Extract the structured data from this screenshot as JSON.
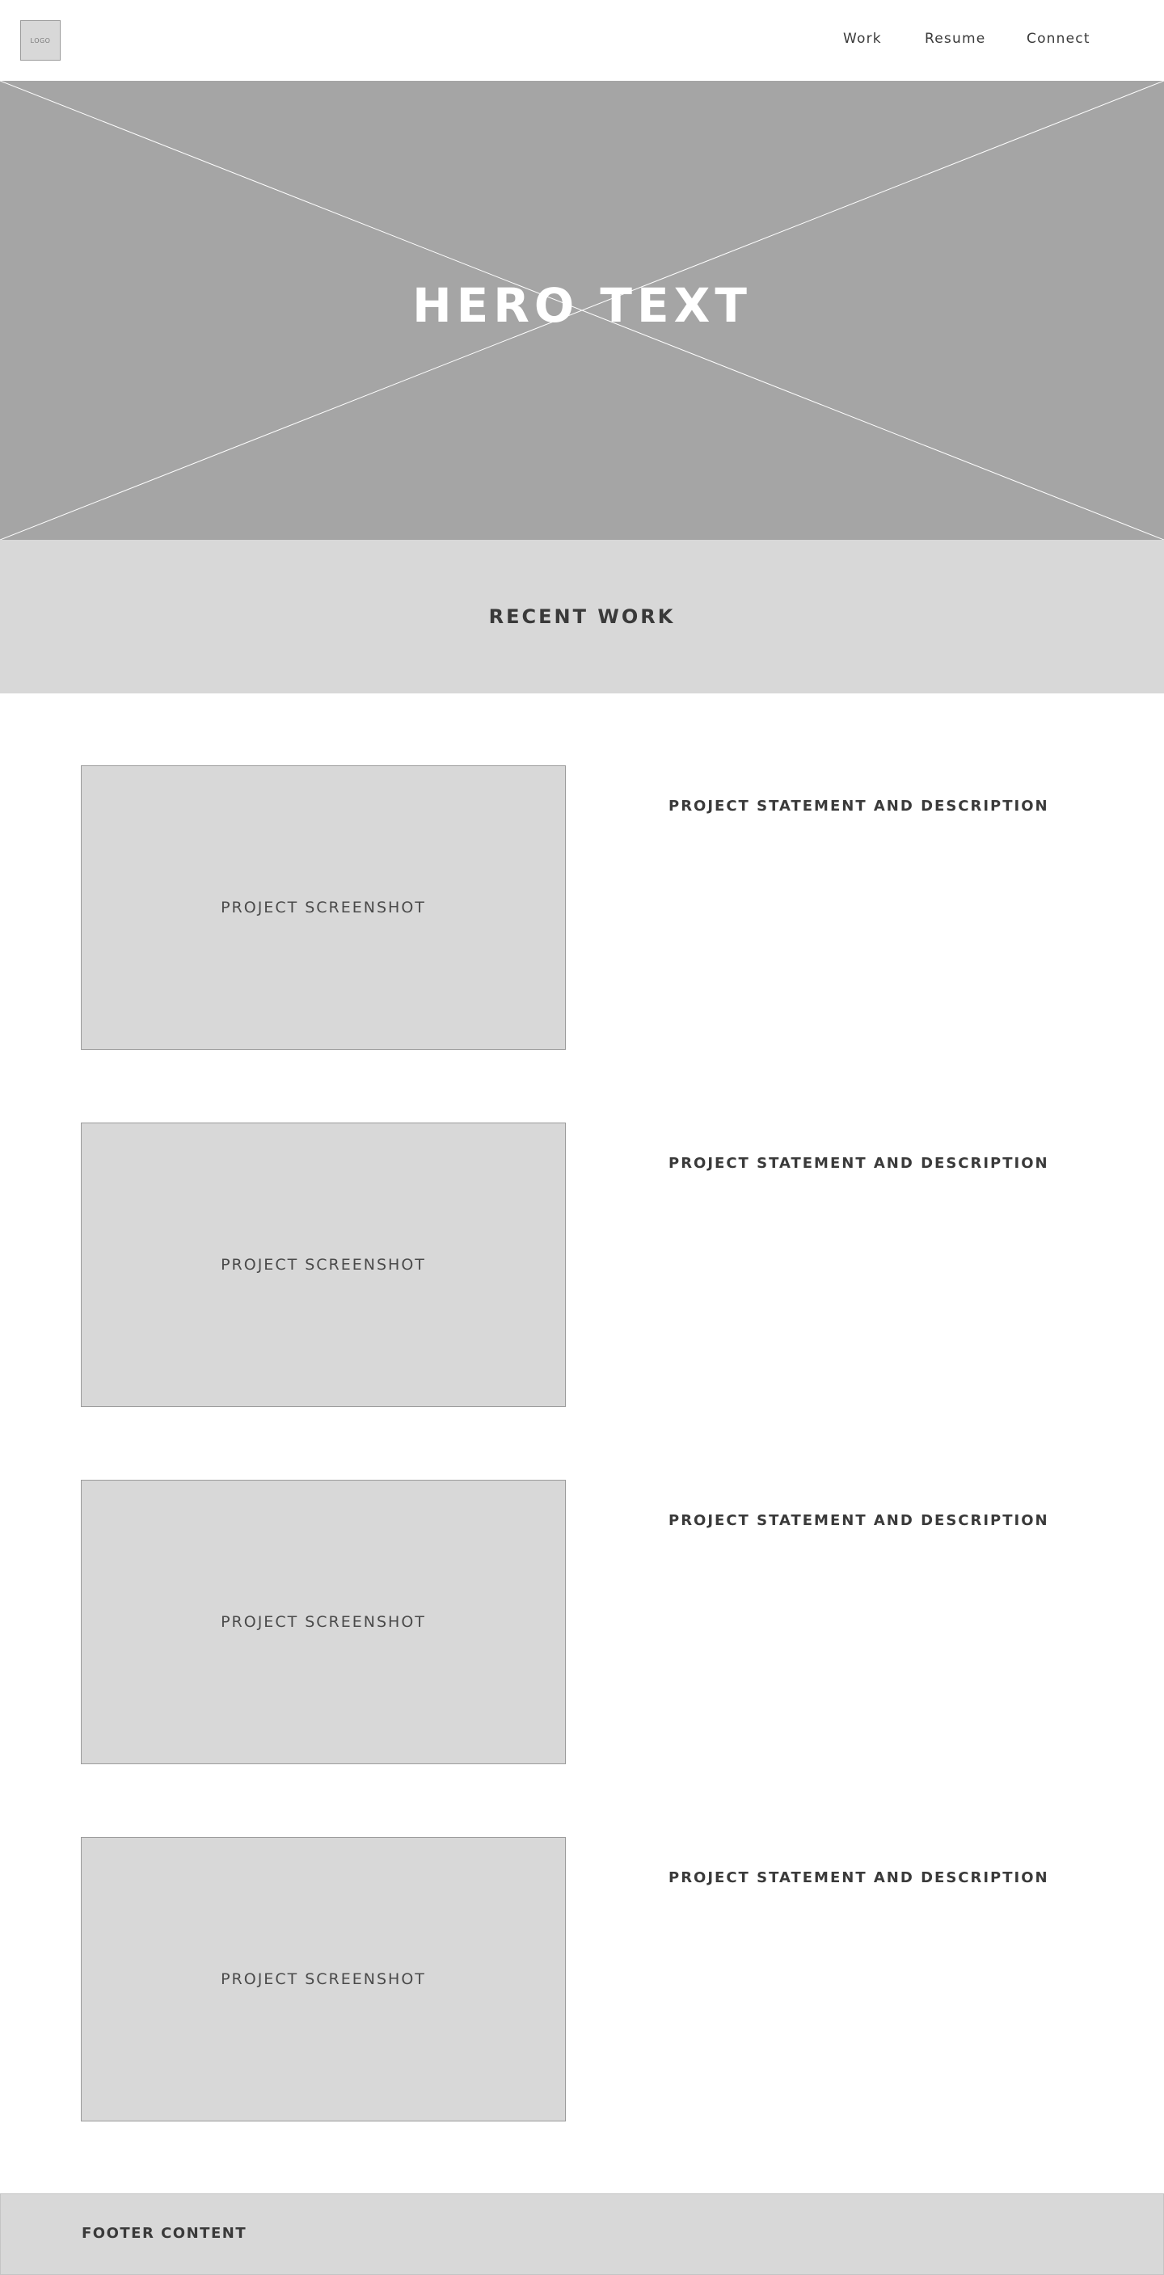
{
  "header": {
    "logo_text": "LOGO",
    "nav": [
      {
        "label": "Work"
      },
      {
        "label": "Resume"
      },
      {
        "label": "Connect"
      }
    ]
  },
  "hero": {
    "text": "HERO TEXT"
  },
  "recent_work": {
    "title": "RECENT WORK"
  },
  "projects": [
    {
      "screenshot_label": "PROJECT SCREENSHOT",
      "statement": "PROJECT STATEMENT AND DESCRIPTION"
    },
    {
      "screenshot_label": "PROJECT SCREENSHOT",
      "statement": "PROJECT STATEMENT AND DESCRIPTION"
    },
    {
      "screenshot_label": "PROJECT SCREENSHOT",
      "statement": "PROJECT STATEMENT AND DESCRIPTION"
    },
    {
      "screenshot_label": "PROJECT SCREENSHOT",
      "statement": "PROJECT STATEMENT AND DESCRIPTION"
    }
  ],
  "footer": {
    "text": "FOOTER CONTENT"
  },
  "colors": {
    "hero_background": "#a5a5a5",
    "panel_background": "#d8d8d8",
    "text": "#3a3a3a",
    "border": "#9b9b9b"
  }
}
